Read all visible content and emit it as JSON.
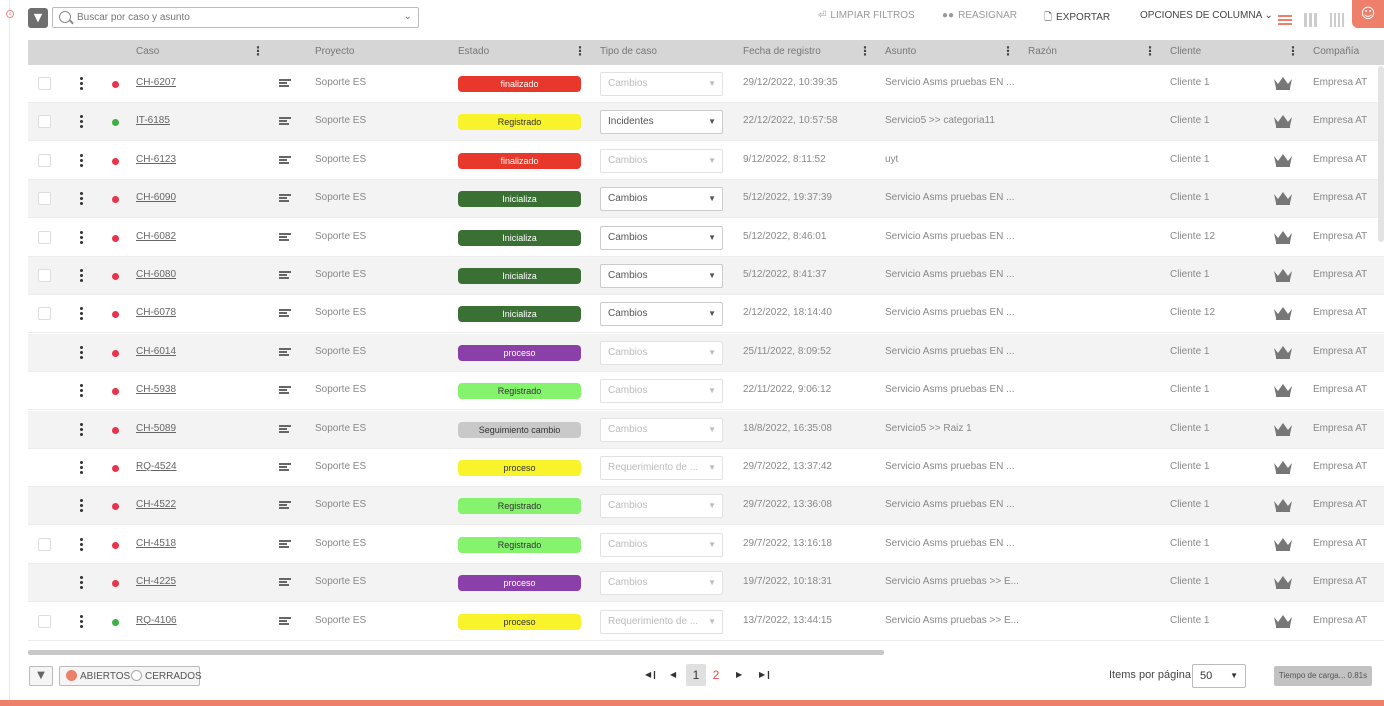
{
  "toolbar": {
    "search_placeholder": "Buscar por caso y asunto",
    "clear_filters": "LIMPIAR FILTROS",
    "reassign": "REASIGNAR",
    "export": "EXPORTAR",
    "column_options": "OPCIONES DE COLUMNA"
  },
  "columns": {
    "caso": "Caso",
    "proyecto": "Proyecto",
    "estado": "Estado",
    "tipo": "Tipo de caso",
    "fecha": "Fecha de registro",
    "asunto": "Asunto",
    "razon": "Razón",
    "cliente": "Cliente",
    "compania": "Compañía"
  },
  "rows": [
    {
      "checkbox": true,
      "dot": "#e8334a",
      "case": "CH-6207",
      "project": "Soporte ES",
      "status": "finalizado",
      "status_bg": "#e8382b",
      "status_fg": "#ffffff",
      "type": "Cambios",
      "type_enabled": false,
      "date": "29/12/2022, 10:39:35",
      "subject": "Servicio Asms pruebas EN ...",
      "client": "Cliente 1",
      "company": "Empresa AT"
    },
    {
      "checkbox": true,
      "dot": "#3cb043",
      "case": "IT-6185",
      "project": "Soporte ES",
      "status": "Registrado",
      "status_bg": "#f8f32b",
      "status_fg": "#333333",
      "type": "Incidentes",
      "type_enabled": true,
      "date": "22/12/2022, 10:57:58",
      "subject": "Servicio5 >> categoria11",
      "client": "Cliente 1",
      "company": "Empresa AT"
    },
    {
      "checkbox": true,
      "dot": "#e8334a",
      "case": "CH-6123",
      "project": "Soporte ES",
      "status": "finalizado",
      "status_bg": "#e8382b",
      "status_fg": "#ffffff",
      "type": "Cambios",
      "type_enabled": false,
      "date": "9/12/2022, 8:11:52",
      "subject": "uyt",
      "client": "Cliente 1",
      "company": "Empresa AT"
    },
    {
      "checkbox": true,
      "dot": "#e8334a",
      "case": "CH-6090",
      "project": "Soporte ES",
      "status": "Inicializa",
      "status_bg": "#3a7034",
      "status_fg": "#ffffff",
      "type": "Cambios",
      "type_enabled": true,
      "date": "5/12/2022, 19:37:39",
      "subject": "Servicio Asms pruebas EN ...",
      "client": "Cliente 1",
      "company": "Empresa AT"
    },
    {
      "checkbox": true,
      "dot": "#e8334a",
      "case": "CH-6082",
      "project": "Soporte ES",
      "status": "Inicializa",
      "status_bg": "#3a7034",
      "status_fg": "#ffffff",
      "type": "Cambios",
      "type_enabled": true,
      "date": "5/12/2022, 8:46:01",
      "subject": "Servicio Asms pruebas EN ...",
      "client": "Cliente 12",
      "company": "Empresa AT"
    },
    {
      "checkbox": true,
      "dot": "#e8334a",
      "case": "CH-6080",
      "project": "Soporte ES",
      "status": "Inicializa",
      "status_bg": "#3a7034",
      "status_fg": "#ffffff",
      "type": "Cambios",
      "type_enabled": true,
      "date": "5/12/2022, 8:41:37",
      "subject": "Servicio Asms pruebas EN ...",
      "client": "Cliente 1",
      "company": "Empresa AT"
    },
    {
      "checkbox": true,
      "dot": "#e8334a",
      "case": "CH-6078",
      "project": "Soporte ES",
      "status": "Inicializa",
      "status_bg": "#3a7034",
      "status_fg": "#ffffff",
      "type": "Cambios",
      "type_enabled": true,
      "date": "2/12/2022, 18:14:40",
      "subject": "Servicio Asms pruebas EN ...",
      "client": "Cliente 12",
      "company": "Empresa AT"
    },
    {
      "checkbox": false,
      "dot": "#e8334a",
      "case": "CH-6014",
      "project": "Soporte ES",
      "status": "proceso",
      "status_bg": "#8b3fa8",
      "status_fg": "#ffffff",
      "type": "Cambios",
      "type_enabled": false,
      "date": "25/11/2022, 8:09:52",
      "subject": "Servicio Asms pruebas EN ...",
      "client": "Cliente 1",
      "company": "Empresa AT"
    },
    {
      "checkbox": false,
      "dot": "#e8334a",
      "case": "CH-5938",
      "project": "Soporte ES",
      "status": "Registrado",
      "status_bg": "#86f36e",
      "status_fg": "#333333",
      "type": "Cambios",
      "type_enabled": false,
      "date": "22/11/2022, 9:06:12",
      "subject": "Servicio Asms pruebas EN ...",
      "client": "Cliente 1",
      "company": "Empresa AT"
    },
    {
      "checkbox": false,
      "dot": "#e8334a",
      "case": "CH-5089",
      "project": "Soporte ES",
      "status": "Seguimiento cambio",
      "status_bg": "#c9c9c9",
      "status_fg": "#333333",
      "type": "Cambios",
      "type_enabled": false,
      "date": "18/8/2022, 16:35:08",
      "subject": "Servicio5 >> Raiz 1",
      "client": "Cliente 1",
      "company": "Empresa AT"
    },
    {
      "checkbox": false,
      "dot": "#e8334a",
      "case": "RQ-4524",
      "project": "Soporte ES",
      "status": "proceso",
      "status_bg": "#f8f32b",
      "status_fg": "#333333",
      "type": "Requerimiento de ...",
      "type_enabled": false,
      "date": "29/7/2022, 13:37:42",
      "subject": "Servicio Asms pruebas EN ...",
      "client": "Cliente 1",
      "company": "Empresa AT"
    },
    {
      "checkbox": false,
      "dot": "#e8334a",
      "case": "CH-4522",
      "project": "Soporte ES",
      "status": "Registrado",
      "status_bg": "#86f36e",
      "status_fg": "#333333",
      "type": "Cambios",
      "type_enabled": false,
      "date": "29/7/2022, 13:36:08",
      "subject": "Servicio Asms pruebas EN ...",
      "client": "Cliente 1",
      "company": "Empresa AT"
    },
    {
      "checkbox": true,
      "dot": "#e8334a",
      "case": "CH-4518",
      "project": "Soporte ES",
      "status": "Registrado",
      "status_bg": "#86f36e",
      "status_fg": "#333333",
      "type": "Cambios",
      "type_enabled": false,
      "date": "29/7/2022, 13:16:18",
      "subject": "Servicio Asms pruebas EN ...",
      "client": "Cliente 1",
      "company": "Empresa AT"
    },
    {
      "checkbox": false,
      "dot": "#e8334a",
      "case": "CH-4225",
      "project": "Soporte ES",
      "status": "proceso",
      "status_bg": "#8b3fa8",
      "status_fg": "#ffffff",
      "type": "Cambios",
      "type_enabled": false,
      "date": "19/7/2022, 10:18:31",
      "subject": "Servicio Asms pruebas >> E...",
      "client": "Cliente 1",
      "company": "Empresa AT"
    },
    {
      "checkbox": true,
      "dot": "#3cb043",
      "case": "RQ-4106",
      "project": "Soporte ES",
      "status": "proceso",
      "status_bg": "#f8f32b",
      "status_fg": "#333333",
      "type": "Requerimiento de ...",
      "type_enabled": false,
      "date": "13/7/2022, 13:44:15",
      "subject": "Servicio Asms pruebas >> E...",
      "client": "Cliente 1",
      "company": "Empresa AT"
    }
  ],
  "footer": {
    "open_label": "ABIERTOS",
    "closed_label": "CERRADOS",
    "pages": [
      "1",
      "2"
    ],
    "current_page": "1",
    "items_per_page_label": "Items por página",
    "items_per_page": "50",
    "load_time": "Tiempo de carga... 0.81s"
  },
  "colors": {
    "accent": "#ee7f6a",
    "header_bg": "#d6d6d6"
  }
}
